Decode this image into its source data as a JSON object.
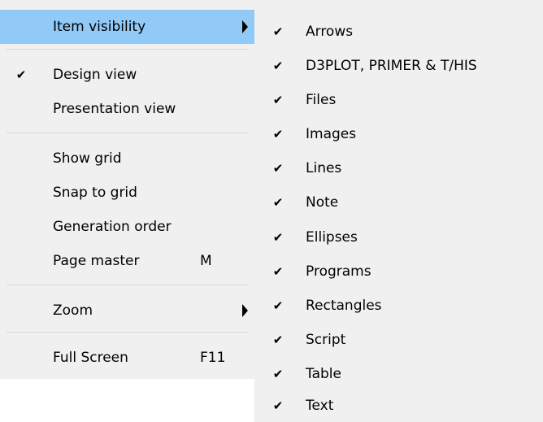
{
  "main_menu": {
    "item_visibility": {
      "label": "Item visibility"
    },
    "design_view": {
      "label": "Design view",
      "check": "✔"
    },
    "presentation_view": {
      "label": "Presentation view"
    },
    "show_grid": {
      "label": "Show grid"
    },
    "snap_to_grid": {
      "label": "Snap to grid"
    },
    "generation_order": {
      "label": "Generation order"
    },
    "page_master": {
      "label": "Page master",
      "shortcut": "M"
    },
    "zoom": {
      "label": "Zoom"
    },
    "full_screen": {
      "label": "Full Screen",
      "shortcut": "F11"
    }
  },
  "submenu": {
    "check": "✔",
    "items": [
      {
        "label": "Arrows"
      },
      {
        "label": "D3PLOT, PRIMER & T/HIS"
      },
      {
        "label": "Files"
      },
      {
        "label": "Images"
      },
      {
        "label": "Lines"
      },
      {
        "label": "Note"
      },
      {
        "label": "Ellipses"
      },
      {
        "label": "Programs"
      },
      {
        "label": "Rectangles"
      },
      {
        "label": "Script"
      },
      {
        "label": "Table"
      },
      {
        "label": "Text"
      }
    ]
  },
  "colors": {
    "menu_background": "#f0f0f0",
    "highlight": "#91c9f7",
    "separator": "#d7d7d7"
  },
  "icons": {
    "submenu_arrow": "chevron-right-icon",
    "check": "check-icon"
  }
}
